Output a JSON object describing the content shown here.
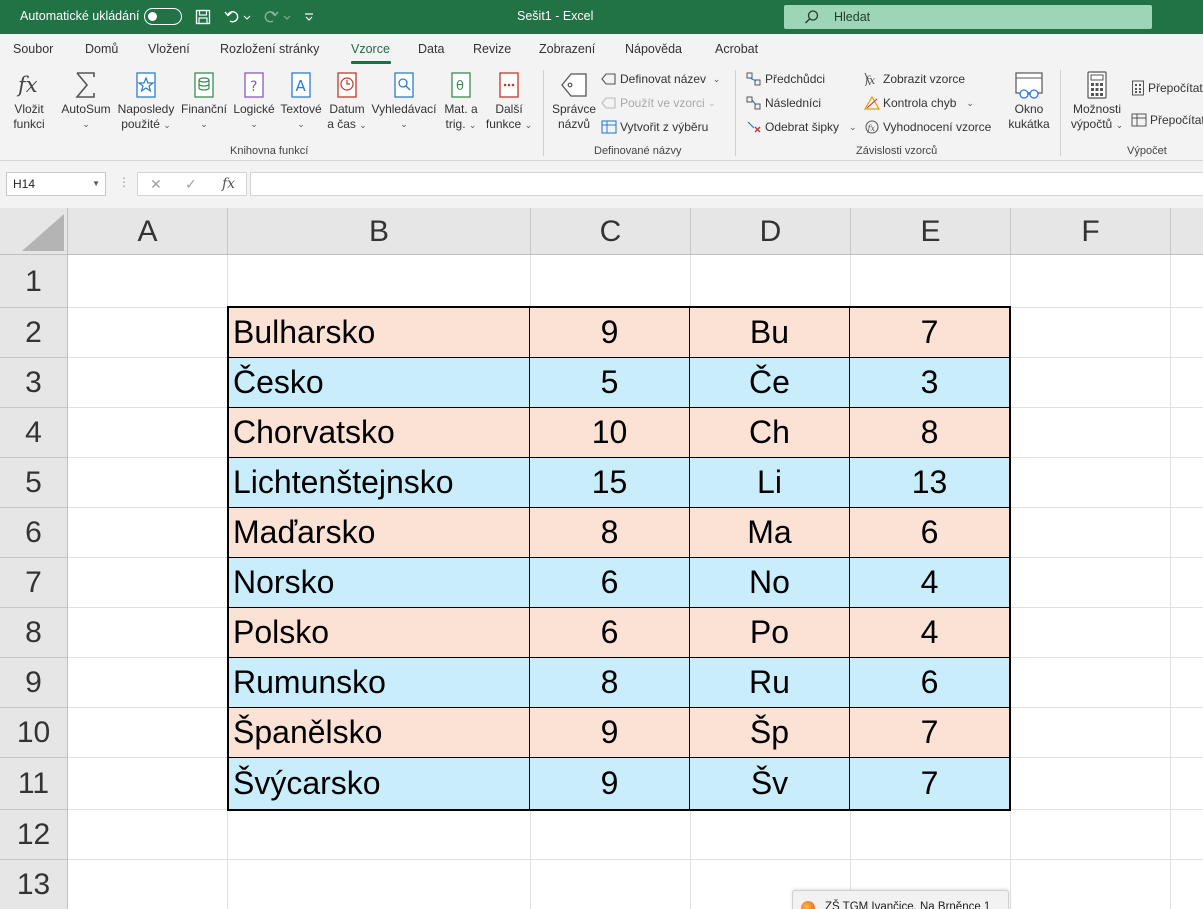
{
  "titlebar": {
    "autosave_label": "Automatické ukládání",
    "doc_title": "Sešit1  -  Excel",
    "search_placeholder": "Hledat",
    "accent": "#217346"
  },
  "tabs": [
    "Soubor",
    "Domů",
    "Vložení",
    "Rozložení stránky",
    "Vzorce",
    "Data",
    "Revize",
    "Zobrazení",
    "Nápověda",
    "Acrobat"
  ],
  "active_tab": "Vzorce",
  "ribbon": {
    "function_library": {
      "label": "Knihovna funkcí",
      "insert_function": [
        "Vložit",
        "funkci"
      ],
      "autosum": "AutoSum",
      "recently_used": [
        "Naposledy",
        "použité"
      ],
      "financial": "Finanční",
      "logical": "Logické",
      "text": "Textové",
      "date_time": [
        "Datum",
        "a čas"
      ],
      "lookup": "Vyhledávací",
      "math_trig": [
        "Mat. a",
        "trig."
      ],
      "more_functions": [
        "Další",
        "funkce"
      ]
    },
    "defined_names": {
      "label": "Definované názvy",
      "name_manager": [
        "Správce",
        "názvů"
      ],
      "define_name": "Definovat název",
      "use_in_formula": "Použít ve vzorci",
      "create_from_selection": "Vytvořit z výběru"
    },
    "formula_auditing": {
      "label": "Závislosti vzorců",
      "trace_precedents": "Předchůdci",
      "trace_dependents": "Následníci",
      "remove_arrows": "Odebrat šipky",
      "show_formulas": "Zobrazit vzorce",
      "error_checking": "Kontrola chyb",
      "evaluate_formula": "Vyhodnocení vzorce",
      "watch_window": [
        "Okno",
        "kukátka"
      ]
    },
    "calculation": {
      "label": "Výpočet",
      "options": [
        "Možnosti",
        "výpočtů"
      ],
      "calc_now": "Přepočítat",
      "calc_sheet": "Přepočítat"
    }
  },
  "formula_bar": {
    "name_box": "H14",
    "fx": "fx",
    "formula": ""
  },
  "grid": {
    "columns": [
      "A",
      "B",
      "C",
      "D",
      "E",
      "F"
    ],
    "rows": [
      "1",
      "2",
      "3",
      "4",
      "5",
      "6",
      "7",
      "8",
      "9",
      "10",
      "11",
      "12",
      "13"
    ],
    "row_colors": {
      "odd": "#fbe2d5",
      "even": "#caedfb"
    },
    "table": [
      [
        "Bulharsko",
        "9",
        "Bu",
        "7"
      ],
      [
        "Česko",
        "5",
        "Če",
        "3"
      ],
      [
        "Chorvatsko",
        "10",
        "Ch",
        "8"
      ],
      [
        "Lichtenštejnsko",
        "15",
        "Li",
        "13"
      ],
      [
        "Maďarsko",
        "8",
        "Ma",
        "6"
      ],
      [
        "Norsko",
        "6",
        "No",
        "4"
      ],
      [
        "Polsko",
        "6",
        "Po",
        "4"
      ],
      [
        "Rumunsko",
        "8",
        "Ru",
        "6"
      ],
      [
        "Španělsko",
        "9",
        "Šp",
        "7"
      ],
      [
        "Švýcarsko",
        "9",
        "Šv",
        "7"
      ]
    ]
  },
  "taskbar_preview": {
    "text": "ZŠ TGM Ivančice, Na Brněnce 1"
  }
}
